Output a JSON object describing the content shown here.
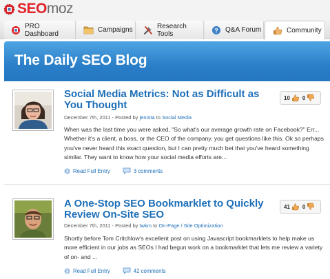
{
  "logo": {
    "seo": "SEO",
    "moz": "moz"
  },
  "nav": {
    "tabs": [
      {
        "label": "PRO Dashboard",
        "icon": "pro-dashboard-icon",
        "active": false
      },
      {
        "label": "Campaigns",
        "icon": "campaigns-folder-icon",
        "active": false
      },
      {
        "label": "Research Tools",
        "icon": "research-tools-icon",
        "active": false
      },
      {
        "label": "Q&A Forum",
        "icon": "qa-forum-icon",
        "active": false
      },
      {
        "label": "Community",
        "icon": "community-hand-icon",
        "active": true
      }
    ]
  },
  "header": {
    "title": "The Daily SEO Blog"
  },
  "colors": {
    "accent": "#1d6fb8",
    "brand_red": "#e0242a",
    "header_blue": "#2a7fc8"
  },
  "posts": [
    {
      "title": "Social Media Metrics: Not as Difficult as You Thought",
      "date": "December 7th, 2011",
      "posted_by": " - Posted by ",
      "author": "jennita",
      "to": " to ",
      "category": "Social Media",
      "excerpt": "When was the last time you were asked, \"So what's our average growth rate on Facebook?\" Err... Whether it's a client, a boss, or the CEO of the company, you get questions like this. Ok so perhaps you've never heard this exact question, but I can pretty much bet that you've heard something similar. They want to know how your social media efforts are...",
      "read_full": "Read Full Entry",
      "comments": "3 comments",
      "thumbs_up": "10",
      "thumbs_down": "0"
    },
    {
      "title": "A One-Stop SEO Bookmarklet to Quickly Review On-Site SEO",
      "date": "December 7th, 2011",
      "posted_by": " - Posted by ",
      "author": "twkm",
      "to": " to ",
      "category": "On-Page / Site Optimization",
      "excerpt": "Shortly before Tom Critchlow's excellent post on using Javascript bookmarklets to help make us more efficient in our jobs as SEOs I had begun work on a bookmarklet that lets me review a variety of on- and ...",
      "read_full": "Read Full Entry",
      "comments": "42 comments",
      "thumbs_up": "41",
      "thumbs_down": "0"
    }
  ]
}
